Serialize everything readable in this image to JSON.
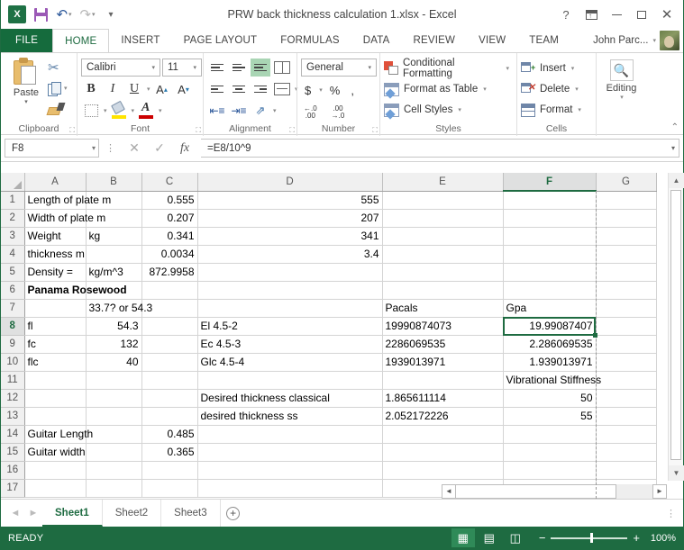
{
  "window": {
    "title": "PRW back thickness calculation 1.xlsx - Excel",
    "qat": [
      {
        "name": "excel-logo",
        "label": "X"
      },
      {
        "name": "save-icon",
        "label": "Save"
      },
      {
        "name": "undo-icon",
        "label": "Undo"
      },
      {
        "name": "redo-icon",
        "label": "Redo"
      },
      {
        "name": "customize-qat-icon",
        "label": "Customize Quick Access Toolbar"
      }
    ],
    "controls": {
      "help": "?",
      "ribbon_display": "Ribbon Display Options",
      "minimize": "Minimize",
      "restore": "Restore Down",
      "close": "✕"
    },
    "user": "John Parc..."
  },
  "tabs": [
    {
      "label": "FILE",
      "active": false
    },
    {
      "label": "HOME",
      "active": true
    },
    {
      "label": "INSERT",
      "active": false
    },
    {
      "label": "PAGE LAYOUT",
      "active": false
    },
    {
      "label": "FORMULAS",
      "active": false
    },
    {
      "label": "DATA",
      "active": false
    },
    {
      "label": "REVIEW",
      "active": false
    },
    {
      "label": "VIEW",
      "active": false
    },
    {
      "label": "TEAM",
      "active": false
    }
  ],
  "ribbon": {
    "groups": [
      {
        "label": "Clipboard"
      },
      {
        "label": "Font"
      },
      {
        "label": "Alignment"
      },
      {
        "label": "Number"
      },
      {
        "label": "Styles"
      },
      {
        "label": "Cells"
      },
      {
        "label": "Editing"
      }
    ],
    "clipboard": {
      "paste": "Paste",
      "cut": "Cut",
      "copy": "Copy",
      "format_painter": "Format Painter"
    },
    "font": {
      "family": "Calibri",
      "size": "11",
      "bold": "B",
      "italic": "I",
      "underline": "U",
      "grow": "A",
      "shrink": "A"
    },
    "number": {
      "format": "General",
      "currency": "$",
      "percent": "%",
      "comma": ",",
      "increase_decimal": "Increase Decimal",
      "decrease_decimal": "Decrease Decimal"
    },
    "styles": {
      "conditional_formatting": "Conditional Formatting",
      "format_as_table": "Format as Table",
      "cell_styles": "Cell Styles"
    },
    "cells": {
      "insert": "Insert",
      "delete": "Delete",
      "format": "Format"
    },
    "editing": {
      "label": "Editing"
    }
  },
  "formula_bar": {
    "name_box": "F8",
    "cancel": "✕",
    "enter": "✓",
    "insert_function": "fx",
    "formula": "=E8/10^9"
  },
  "grid": {
    "columns": [
      "A",
      "B",
      "C",
      "D",
      "E",
      "F",
      "G"
    ],
    "selected_column": "F",
    "selected_row": 8,
    "selected_cell": "F8",
    "rows": [
      {
        "n": "1",
        "A": "Length of plate m",
        "B": "",
        "C": "0.555",
        "D": "555",
        "E": "",
        "F": "",
        "G": ""
      },
      {
        "n": "2",
        "A": "Width of plate m",
        "B": "",
        "C": "0.207",
        "D": "207",
        "E": "",
        "F": "",
        "G": ""
      },
      {
        "n": "3",
        "A": "Weight",
        "B": "kg",
        "C": "0.341",
        "D": "341",
        "E": "",
        "F": "",
        "G": ""
      },
      {
        "n": "4",
        "A": "thickness m",
        "B": "",
        "C": "0.0034",
        "D": "3.4",
        "E": "",
        "F": "",
        "G": ""
      },
      {
        "n": "5",
        "A": "Density =",
        "B": "kg/m^3",
        "C": "872.9958",
        "D": "",
        "E": "",
        "F": "",
        "G": ""
      },
      {
        "n": "6",
        "A": "Panama Rosewood",
        "B": "",
        "C": "",
        "D": "",
        "E": "",
        "F": "",
        "G": "",
        "bold": true
      },
      {
        "n": "7",
        "A": "",
        "B": "33.7? or 54.3",
        "C": "",
        "D": "",
        "E": "",
        "F": "",
        "G": ""
      },
      {
        "n": "8",
        "A": "fl",
        "B": "54.3",
        "C": "",
        "D": "El 4.5-2",
        "E": "19990874073",
        "F": "19.99087407",
        "G": ""
      },
      {
        "n": "9",
        "A": "fc",
        "B": "132",
        "C": "",
        "D": "Ec 4.5-3",
        "E": "2286069535",
        "F": "2.286069535",
        "G": ""
      },
      {
        "n": "10",
        "A": "flc",
        "B": "40",
        "C": "",
        "D": "Glc 4.5-4",
        "E": "1939013971",
        "F": "1.939013971",
        "G": ""
      },
      {
        "n": "11",
        "A": "",
        "B": "",
        "C": "",
        "D": "",
        "E": "",
        "F": "Vibrational Stiffness",
        "G": ""
      },
      {
        "n": "12",
        "A": "",
        "B": "",
        "C": "",
        "D": "Desired thickness classical",
        "E": "1.865611114",
        "F": "50",
        "G": ""
      },
      {
        "n": "13",
        "A": "",
        "B": "",
        "C": "",
        "D": "desired thickness ss",
        "E": "2.052172226",
        "F": "55",
        "G": ""
      },
      {
        "n": "14",
        "A": "Guitar Length",
        "B": "",
        "C": "0.485",
        "D": "",
        "E": "",
        "F": "",
        "G": ""
      },
      {
        "n": "15",
        "A": "Guitar width",
        "B": "",
        "C": "0.365",
        "D": "",
        "E": "",
        "F": "",
        "G": ""
      },
      {
        "n": "16",
        "A": "",
        "B": "",
        "C": "",
        "D": "",
        "E": "",
        "F": "",
        "G": ""
      },
      {
        "n": "17",
        "A": "",
        "B": "",
        "C": "",
        "D": "",
        "E": "",
        "F": "",
        "G": ""
      }
    ],
    "header_row_7": {
      "E": "Pacals",
      "F": "Gpa"
    }
  },
  "sheet_tabs": {
    "prev": "◄",
    "next": "►",
    "sheets": [
      {
        "label": "Sheet1",
        "active": true
      },
      {
        "label": "Sheet2",
        "active": false
      },
      {
        "label": "Sheet3",
        "active": false
      }
    ],
    "add": "+"
  },
  "status_bar": {
    "mode": "READY",
    "views": [
      {
        "name": "normal-view-icon",
        "glyph": "▦",
        "active": true
      },
      {
        "name": "page-layout-view-icon",
        "glyph": "▤",
        "active": false
      },
      {
        "name": "page-break-preview-icon",
        "glyph": "◫",
        "active": false
      }
    ],
    "zoom_out": "−",
    "zoom_in": "+",
    "zoom_level": "100%"
  },
  "colors": {
    "accent": "#1e6b41",
    "file_tab": "#156b3d",
    "selection": "#1e6b41",
    "header_bg": "#f0f0f0"
  }
}
